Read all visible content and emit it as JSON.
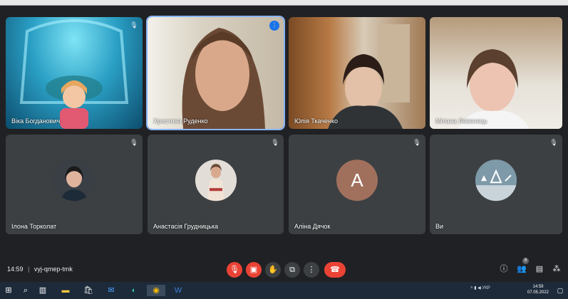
{
  "participants": [
    {
      "name": "Віка Богданович"
    },
    {
      "name": "Христина Руденко"
    },
    {
      "name": "Юлія Ткаченко"
    },
    {
      "name": "Мілана Левенець"
    },
    {
      "name": "Ілона Торколат"
    },
    {
      "name": "Анастасія Грудницька"
    },
    {
      "name": "Аліна Дячок",
      "initial": "A"
    },
    {
      "name": "Ви"
    }
  ],
  "meeting": {
    "time": "14:59",
    "separator": "|",
    "code": "vyj-qmep-tmk"
  },
  "people_count": "8",
  "taskbar": {
    "lang": "УКР",
    "time": "14:59",
    "date": "07.05.2022"
  },
  "colors": {
    "background": "#202124",
    "tile": "#3c4043",
    "end_call": "#ea4335",
    "letter_avatar": "#a1705d",
    "speaking": "#1a73e8"
  }
}
